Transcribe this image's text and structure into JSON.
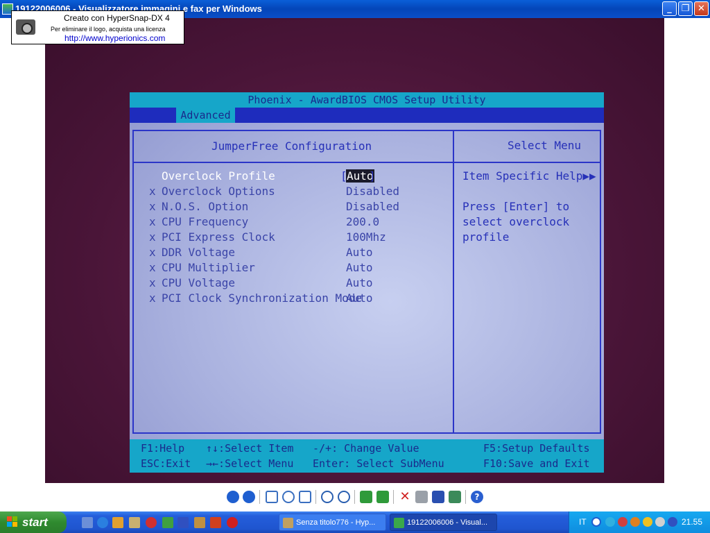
{
  "window": {
    "title": "19122006006 - Visualizzatore immagini e fax per Windows",
    "minimize_glyph": "_",
    "maximize_glyph": "❐",
    "close_glyph": "✕"
  },
  "watermark": {
    "line1": "Creato con HyperSnap-DX 4",
    "line2": "Per eliminare il logo, acquista una licenza",
    "line3": "http://www.hyperionics.com"
  },
  "bios": {
    "title": "Phoenix - AwardBIOS CMOS Setup Utility",
    "active_tab": "Advanced",
    "left_heading": "JumperFree Configuration",
    "right_heading": "Select Menu",
    "disabled_mark": "x",
    "selected_open_bracket": "[",
    "selected_close_bracket": "]",
    "options": [
      {
        "label": "Overclock Profile",
        "value": "Auto",
        "disabled": false,
        "selected": true
      },
      {
        "label": "Overclock Options",
        "value": "Disabled",
        "disabled": true,
        "selected": false
      },
      {
        "label": "N.O.S. Option",
        "value": "Disabled",
        "disabled": true,
        "selected": false
      },
      {
        "label": "CPU Frequency",
        "value": "200.0",
        "disabled": true,
        "selected": false
      },
      {
        "label": "PCI Express Clock",
        "value": "100Mhz",
        "disabled": true,
        "selected": false
      },
      {
        "label": "DDR Voltage",
        "value": "Auto",
        "disabled": true,
        "selected": false
      },
      {
        "label": "CPU Multiplier",
        "value": "Auto",
        "disabled": true,
        "selected": false
      },
      {
        "label": "CPU Voltage",
        "value": "Auto",
        "disabled": true,
        "selected": false
      },
      {
        "label": "PCI Clock Synchronization Mode",
        "value": "Auto",
        "disabled": true,
        "selected": false
      }
    ],
    "help": {
      "title": "Item Specific Help▶▶",
      "lines": [
        "Press [Enter] to",
        "select overclock",
        "profile"
      ]
    },
    "footer": {
      "f1": "F1:Help",
      "esc": "ESC:Exit",
      "select_item": "↑↓:Select Item",
      "select_menu": "→←:Select Menu",
      "change_value": "-/+: Change Value",
      "select_submenu": "Enter: Select SubMenu",
      "f5": "F5:Setup Defaults",
      "f10": "F10:Save and Exit"
    }
  },
  "toolbar_icons": [
    "previous-icon",
    "next-icon",
    "best-fit-icon",
    "actual-size-icon",
    "slideshow-icon",
    "zoom-in-icon",
    "zoom-out-icon",
    "rotate-clockwise-icon",
    "rotate-counterclockwise-icon",
    "delete-icon",
    "print-icon",
    "save-icon",
    "edit-icon",
    "help-icon"
  ],
  "taskbar": {
    "start_label": "start",
    "tasks": [
      {
        "label": "Senza titolo776 - Hyp...",
        "active": false
      },
      {
        "label": "19122006006 - Visual...",
        "active": true
      }
    ],
    "language": "IT",
    "clock": "21.55"
  },
  "colors": {
    "bios_cyan": "#16a6c9",
    "bios_blue": "#1e2cbd",
    "bios_text": "#2630b8",
    "photo_bg": "#4a1538",
    "xp_blue": "#245edb",
    "start_green": "#2f8a2f"
  }
}
